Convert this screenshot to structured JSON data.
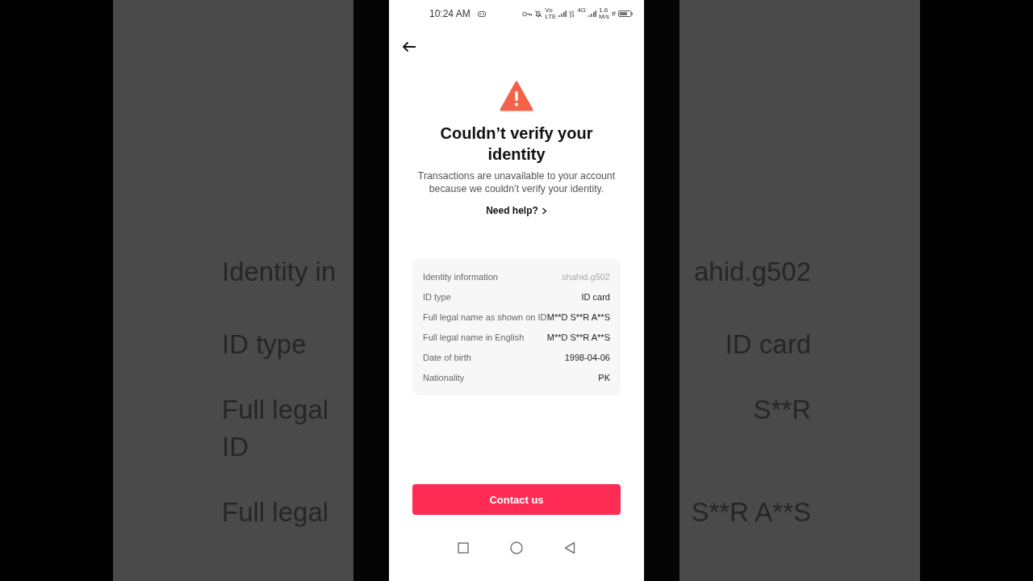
{
  "backdrop": {
    "rows": [
      {
        "label": "Identity in",
        "value": "ahid.g502"
      },
      {
        "label": "ID type",
        "value": "ID card"
      },
      {
        "label": "Full legal",
        "value": "S**R"
      },
      {
        "label": "ID"
      },
      {
        "label": "Full legal",
        "value": "S**R A**S"
      }
    ]
  },
  "status_bar": {
    "time": "10:24 AM",
    "volte": "Vo",
    "lte": "LTE",
    "network": "4G",
    "speed": "1.6",
    "speed_unit": "M/s",
    "hash": "#"
  },
  "title": "Couldn’t verify your identity",
  "message": "Transactions are unavailable to your account because we couldn’t verify your identity.",
  "help_link": "Need help?",
  "identity_card": {
    "rows": [
      {
        "label": "Identity information",
        "value": "shahid.g502",
        "muted": true
      },
      {
        "label": "ID type",
        "value": "ID card",
        "muted": false
      },
      {
        "label": "Full legal name as shown on ID",
        "value": "M**D S**R A**S",
        "muted": false
      },
      {
        "label": "Full legal name in English",
        "value": "M**D S**R A**S",
        "muted": false
      },
      {
        "label": "Date of birth",
        "value": "1998-04-06",
        "muted": false
      },
      {
        "label": "Nationality",
        "value": "PK",
        "muted": false
      }
    ]
  },
  "primary_button": "Contact us"
}
